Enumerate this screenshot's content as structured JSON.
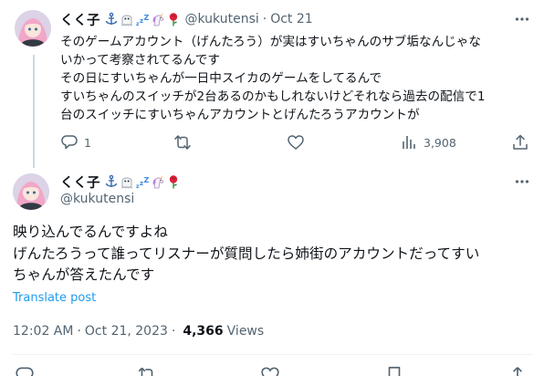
{
  "reply_tweet": {
    "display_name": "くく子",
    "emoji_icons": [
      "anchor-icon",
      "ghost-icon",
      "sleeping-zzz-icon",
      "unicorn-icon",
      "rose-icon"
    ],
    "handle": "@kukutensi",
    "separator": "·",
    "date": "Oct 21",
    "text_lines": [
      "そのゲームアカウント（げんたろう）が実はすいちゃんのサブ垢なんじゃな",
      "いかって考察されてるんです",
      "その日にすいちゃんが一日中スイカのゲームをしてるんで",
      "すいちゃんのスイッチが2台あるのかもしれないけどそれなら過去の配信で1",
      "台のスイッチにすいちゃんアカウントとげんたろうアカウントが"
    ],
    "actions": {
      "reply_count": "1",
      "retweet_count": "",
      "like_count": "",
      "views_count": "3,908"
    }
  },
  "main_tweet": {
    "display_name": "くく子",
    "emoji_icons": [
      "anchor-icon",
      "ghost-icon",
      "sleeping-zzz-icon",
      "unicorn-icon",
      "rose-icon"
    ],
    "handle": "@kukutensi",
    "text_lines": [
      "映り込んでるんですよね",
      "げんたろうって誰ってリスナーが質問したら姉街のアカウントだってすい",
      "ちゃんが答えたんです"
    ],
    "translate_label": "Translate post",
    "time": "12:02 AM",
    "separator": "·",
    "date": "Oct 21, 2023",
    "meta_separator": "·",
    "views_count": "4,366",
    "views_label": "Views"
  },
  "colors": {
    "text_primary": "#0f1419",
    "text_secondary": "#536471",
    "link_blue": "#1d9bf0",
    "divider": "#eff3f4",
    "thread_line": "#cfd9de"
  }
}
